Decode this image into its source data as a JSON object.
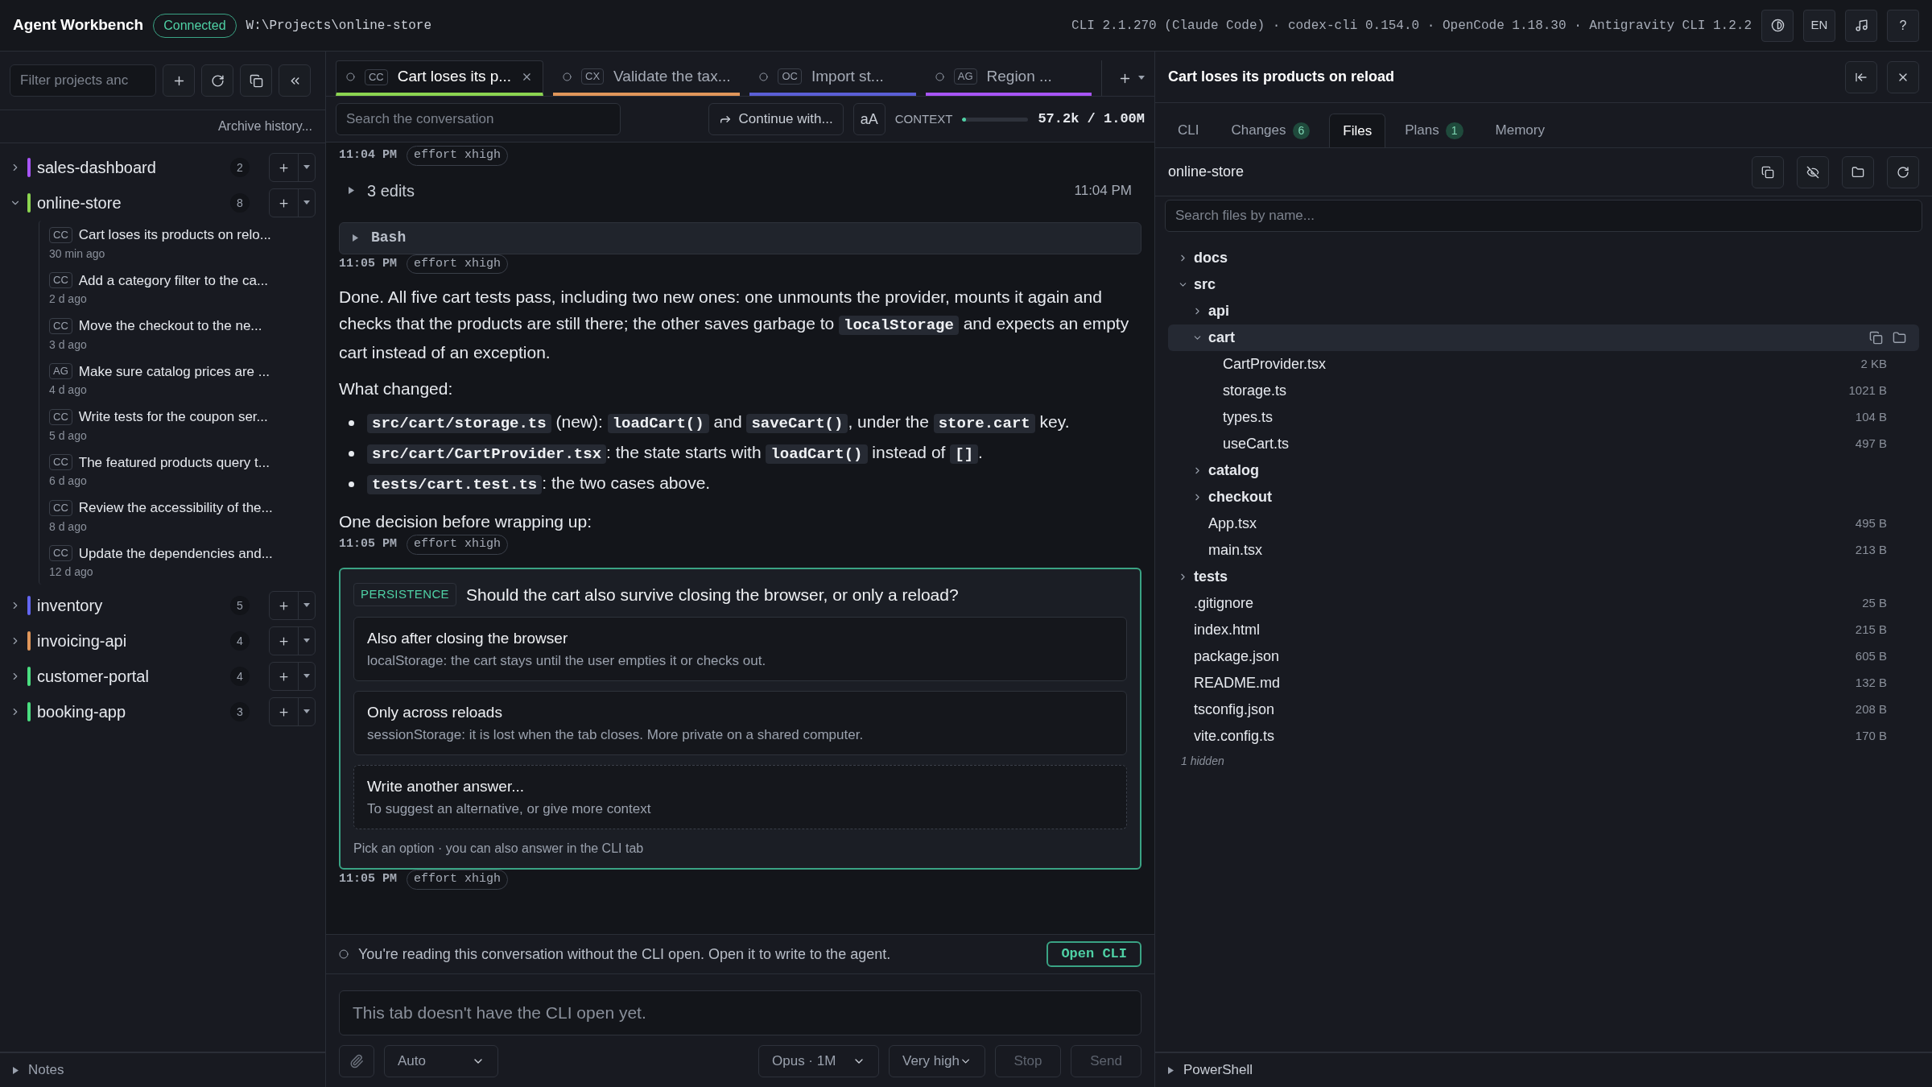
{
  "header": {
    "app_title": "Agent Workbench",
    "status": "Connected",
    "path": "W:\\Projects\\online-store",
    "versions": "CLI 2.1.270 (Claude Code) · codex-cli 0.154.0 · OpenCode 1.18.30 · Antigravity CLI 1.2.2",
    "language": "EN",
    "help": "?"
  },
  "sidebar": {
    "filter_placeholder": "Filter projects anc",
    "archive_link": "Archive history...",
    "projects": [
      {
        "name": "sales-dashboard",
        "color": "#a855f7",
        "count": "2",
        "expanded": false
      },
      {
        "name": "online-store",
        "color": "#8bd450",
        "count": "8",
        "expanded": true,
        "conversations": [
          {
            "agent": "CC",
            "title": "Cart loses its products on relo...",
            "time": "30 min ago"
          },
          {
            "agent": "CC",
            "title": "Add a category filter to the ca...",
            "time": "2 d ago"
          },
          {
            "agent": "CC",
            "title": "Move the checkout to the ne...",
            "time": "3 d ago"
          },
          {
            "agent": "AG",
            "title": "Make sure catalog prices are ...",
            "time": "4 d ago"
          },
          {
            "agent": "CC",
            "title": "Write tests for the coupon ser...",
            "time": "5 d ago"
          },
          {
            "agent": "CC",
            "title": "The featured products query t...",
            "time": "6 d ago"
          },
          {
            "agent": "CC",
            "title": "Review the accessibility of the...",
            "time": "8 d ago"
          },
          {
            "agent": "CC",
            "title": "Update the dependencies and...",
            "time": "12 d ago"
          }
        ]
      },
      {
        "name": "inventory",
        "color": "#6366f1",
        "count": "5",
        "expanded": false
      },
      {
        "name": "invoicing-api",
        "color": "#e0965a",
        "count": "4",
        "expanded": false
      },
      {
        "name": "customer-portal",
        "color": "#4ade80",
        "count": "4",
        "expanded": false
      },
      {
        "name": "booking-app",
        "color": "#4ade80",
        "count": "3",
        "expanded": false
      }
    ],
    "notes_label": "Notes"
  },
  "tabs": [
    {
      "agent": "CC",
      "title": "Cart loses its p...",
      "color": "#8bd450",
      "selected": true
    },
    {
      "agent": "CX",
      "title": "Validate the tax...",
      "color": "#e0965a",
      "selected": false
    },
    {
      "agent": "OC",
      "title": "Import st...",
      "color": "#5b5fd6",
      "selected": false
    },
    {
      "agent": "AG",
      "title": "Region ...",
      "color": "#a855f7",
      "selected": false
    }
  ],
  "toolbar": {
    "search_placeholder": "Search the conversation",
    "continue_button": "Continue with...",
    "font_button": "aA",
    "context_label": "CONTEXT",
    "level": 0.06,
    "context_reading": "57.2k / 1.00M"
  },
  "messages": [
    {
      "kind": "meta",
      "time": "11:04 PM",
      "tag": "effort xhigh"
    },
    {
      "kind": "collapsible",
      "label": "3 edits",
      "time": "11:04 PM"
    },
    {
      "kind": "tool",
      "label": "Bash"
    },
    {
      "kind": "meta",
      "time": "11:05 PM",
      "tag": "effort xhigh"
    },
    {
      "kind": "paragraph",
      "segments": [
        {
          "text": "Done. All five cart tests pass, including two new ones: one unmounts the provider, mounts it again and checks that the products are still there; the other saves garbage to ",
          "code": false
        },
        {
          "text": "localStorage",
          "code": true
        },
        {
          "text": " and expects an empty cart instead of an exception.",
          "code": false
        }
      ]
    },
    {
      "kind": "paragraph",
      "segments": [
        {
          "text": "What changed:",
          "code": false
        }
      ]
    },
    {
      "kind": "bullets",
      "items": [
        {
          "segments": [
            {
              "text": "src/cart/storage.ts",
              "code": true
            },
            {
              "text": " (new): ",
              "code": false
            },
            {
              "text": "loadCart()",
              "code": true
            },
            {
              "text": " and ",
              "code": false
            },
            {
              "text": "saveCart()",
              "code": true
            },
            {
              "text": ", under the ",
              "code": false
            },
            {
              "text": "store.cart",
              "code": true
            },
            {
              "text": " key.",
              "code": false
            }
          ]
        },
        {
          "segments": [
            {
              "text": "src/cart/CartProvider.tsx",
              "code": true
            },
            {
              "text": ": the state starts with ",
              "code": false
            },
            {
              "text": "loadCart()",
              "code": true
            },
            {
              "text": " instead of ",
              "code": false
            },
            {
              "text": "[]",
              "code": true
            },
            {
              "text": ".",
              "code": false
            }
          ]
        },
        {
          "segments": [
            {
              "text": "tests/cart.test.ts",
              "code": true
            },
            {
              "text": ": the two cases above.",
              "code": false
            }
          ]
        }
      ]
    },
    {
      "kind": "paragraph",
      "segments": [
        {
          "text": "One decision before wrapping up:",
          "code": false
        }
      ]
    },
    {
      "kind": "meta",
      "time": "11:05 PM",
      "tag": "effort xhigh"
    },
    {
      "kind": "question",
      "tag": "PERSISTENCE",
      "question": "Should the cart also survive closing the browser, or only a reload?",
      "options": [
        {
          "kind": "option",
          "title": "Also after closing the browser",
          "description": "localStorage: the cart stays until the user empties it or checks out."
        },
        {
          "kind": "option",
          "title": "Only across reloads",
          "description": "sessionStorage: it is lost when the tab closes. More private on a shared computer."
        },
        {
          "kind": "custom",
          "title": "Write another answer...",
          "description": "To suggest an alternative, or give more context"
        }
      ],
      "footnote": "Pick an option · you can also answer in the CLI tab"
    },
    {
      "kind": "meta",
      "time": "11:05 PM",
      "tag": "effort xhigh"
    }
  ],
  "notice": {
    "text": "You're reading this conversation without the CLI open. Open it to write to the agent.",
    "button": "Open CLI"
  },
  "composer": {
    "placeholder": "This tab doesn't have the CLI open yet.",
    "mode": "Auto",
    "model": "Opus · 1M",
    "effort": "Very high",
    "stop": "Stop",
    "send": "Send",
    "disabled": true
  },
  "panel": {
    "title": "Cart loses its products on reload",
    "tabs": [
      {
        "label": "CLI",
        "selected": false
      },
      {
        "label": "Changes",
        "count": "6",
        "selected": false
      },
      {
        "label": "Files",
        "selected": true
      },
      {
        "label": "Plans",
        "count": "1",
        "selected": false
      },
      {
        "label": "Memory",
        "selected": false
      }
    ],
    "root": "online-store",
    "search_placeholder": "Search files by name...",
    "tree": [
      {
        "kind": "folder",
        "name": "docs",
        "expanded": false,
        "selected": false
      },
      {
        "kind": "folder",
        "name": "src",
        "expanded": true,
        "selected": false,
        "children": [
          {
            "kind": "folder",
            "name": "api",
            "expanded": false,
            "selected": false
          },
          {
            "kind": "folder",
            "name": "cart",
            "expanded": true,
            "selected": true,
            "children": [
              {
                "kind": "file",
                "name": "CartProvider.tsx",
                "size": "2 KB",
                "selected": false
              },
              {
                "kind": "file",
                "name": "storage.ts",
                "size": "1021 B",
                "selected": false
              },
              {
                "kind": "file",
                "name": "types.ts",
                "size": "104 B",
                "selected": false
              },
              {
                "kind": "file",
                "name": "useCart.ts",
                "size": "497 B",
                "selected": false
              }
            ]
          },
          {
            "kind": "folder",
            "name": "catalog",
            "expanded": false,
            "selected": false
          },
          {
            "kind": "folder",
            "name": "checkout",
            "expanded": false,
            "selected": false
          },
          {
            "kind": "file",
            "name": "App.tsx",
            "size": "495 B",
            "selected": false
          },
          {
            "kind": "file",
            "name": "main.tsx",
            "size": "213 B",
            "selected": false
          }
        ]
      },
      {
        "kind": "folder",
        "name": "tests",
        "expanded": false,
        "selected": false
      },
      {
        "kind": "file",
        "name": ".gitignore",
        "size": "25 B",
        "selected": false
      },
      {
        "kind": "file",
        "name": "index.html",
        "size": "215 B",
        "selected": false
      },
      {
        "kind": "file",
        "name": "package.json",
        "size": "605 B",
        "selected": false
      },
      {
        "kind": "file",
        "name": "README.md",
        "size": "132 B",
        "selected": false
      },
      {
        "kind": "file",
        "name": "tsconfig.json",
        "size": "208 B",
        "selected": false
      },
      {
        "kind": "file",
        "name": "vite.config.ts",
        "size": "170 B",
        "selected": false
      }
    ],
    "hidden_note": "1 hidden",
    "terminal_label": "PowerShell"
  }
}
